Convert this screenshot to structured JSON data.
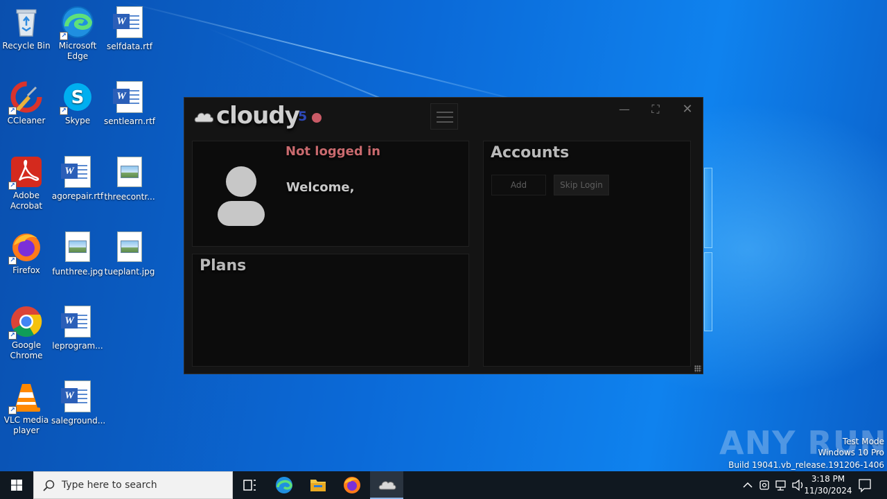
{
  "desktop": {
    "icons": [
      {
        "label": "Recycle Bin",
        "icon": "recycle-bin-icon"
      },
      {
        "label": "Microsoft Edge",
        "icon": "edge-icon"
      },
      {
        "label": "selfdata.rtf",
        "icon": "word-doc-icon"
      },
      {
        "label": "CCleaner",
        "icon": "ccleaner-icon"
      },
      {
        "label": "Skype",
        "icon": "skype-icon"
      },
      {
        "label": "sentlearn.rtf",
        "icon": "word-doc-icon"
      },
      {
        "label": "Adobe Acrobat",
        "icon": "acrobat-icon"
      },
      {
        "label": "agorepair.rtf",
        "icon": "word-doc-icon"
      },
      {
        "label": "threecontr...",
        "icon": "image-file-icon"
      },
      {
        "label": "Firefox",
        "icon": "firefox-icon"
      },
      {
        "label": "funthree.jpg",
        "icon": "image-file-icon"
      },
      {
        "label": "tueplant.jpg",
        "icon": "image-file-icon"
      },
      {
        "label": "Google Chrome",
        "icon": "chrome-icon"
      },
      {
        "label": "leprogram...",
        "icon": "word-doc-icon"
      },
      {
        "label": "VLC media player",
        "icon": "vlc-icon"
      },
      {
        "label": "saleground...",
        "icon": "word-doc-icon"
      }
    ]
  },
  "app": {
    "logo_text": "cloudy",
    "logo_version": "5",
    "window_controls": {
      "minimize": "—",
      "maximize": "⛶",
      "close": "✕"
    },
    "profile": {
      "status": "Not logged in",
      "welcome": "Welcome,"
    },
    "plans": {
      "title": "Plans"
    },
    "accounts": {
      "title": "Accounts",
      "add_label": "Add",
      "skip_label": "Skip Login"
    },
    "colors": {
      "status_dot": "#c95a66",
      "status_text": "#c96a6e",
      "version": "#2d48b8"
    }
  },
  "watermark": {
    "brand": "ANY RUN",
    "line1": "Test Mode",
    "line2": "Windows 10 Pro",
    "line3": "Build 19041.vb_release.191206-1406"
  },
  "taskbar": {
    "search_placeholder": "Type here to search",
    "time": "3:18 PM",
    "date": "11/30/2024"
  }
}
